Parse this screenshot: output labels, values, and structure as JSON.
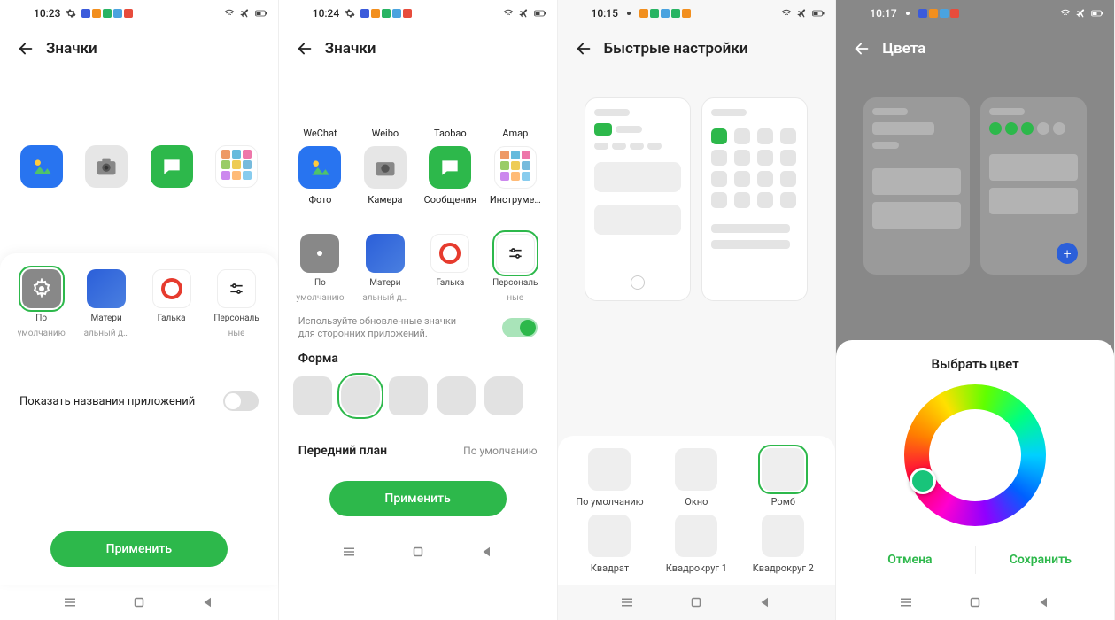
{
  "statusbar_dots": [
    "#3b5bdb",
    "#f28f1e",
    "#28b463",
    "#4aa3df",
    "#e74c3c"
  ],
  "statusbar_dots_s3": [
    "#f28f1e",
    "#28b463",
    "#4aa3df",
    "#28b463",
    "#f28f1e"
  ],
  "screen1": {
    "time": "10:23",
    "title": "Значки",
    "preview_icons": [
      {
        "name": "photos",
        "bg": "#2874f0"
      },
      {
        "name": "camera",
        "bg": "#e6e6e6"
      },
      {
        "name": "messages",
        "bg": "#2db84b"
      },
      {
        "name": "tools-folder",
        "multi": true
      }
    ],
    "styles": [
      {
        "name": "default",
        "label": "По",
        "label2": "умолчанию",
        "selected": true,
        "kind": "gear"
      },
      {
        "name": "material",
        "label": "Матери",
        "label2": "альный д…",
        "kind": "material"
      },
      {
        "name": "pebble",
        "label": "Галька",
        "kind": "circle"
      },
      {
        "name": "custom",
        "label": "Персональ",
        "label2": "ные",
        "kind": "sliders"
      }
    ],
    "show_names_label": "Показать названия приложений",
    "show_names_on": false,
    "apply": "Применить"
  },
  "screen2": {
    "time": "10:24",
    "title": "Значки",
    "row1": [
      {
        "name": "wechat",
        "label": "WeChat",
        "bg": "#2db84b"
      },
      {
        "name": "weibo",
        "label": "Weibo",
        "bg": "#e6e6e6"
      },
      {
        "name": "taobao",
        "label": "Taobao",
        "bg": "#2db84b"
      },
      {
        "name": "amap",
        "label": "Amap",
        "multi": true
      }
    ],
    "row2": [
      {
        "name": "photos",
        "label": "Фото",
        "bg": "#2874f0"
      },
      {
        "name": "camera",
        "label": "Камера",
        "bg": "#e6e6e6"
      },
      {
        "name": "messages",
        "label": "Сообщения",
        "bg": "#2db84b"
      },
      {
        "name": "tools",
        "label": "Инструме…",
        "multi": true
      }
    ],
    "styles": [
      {
        "name": "default",
        "label": "По",
        "label2": "умолчанию",
        "kind": "gear"
      },
      {
        "name": "material",
        "label": "Матери",
        "label2": "альный д…",
        "kind": "material"
      },
      {
        "name": "pebble",
        "label": "Галька",
        "kind": "circle"
      },
      {
        "name": "custom",
        "label": "Персональ",
        "label2": "ные",
        "kind": "sliders",
        "selected": true
      }
    ],
    "use_updated_desc": "Используйте обновленные значки для сторонних приложений.",
    "use_updated_on": true,
    "shape_title": "Форма",
    "shapes": [
      "r10",
      "squircle",
      "r10",
      "r14",
      "r14"
    ],
    "shape_selected": 1,
    "foreground_label": "Передний план",
    "foreground_value": "По умолчанию",
    "apply": "Применить"
  },
  "screen3": {
    "time": "10:15",
    "title": "Быстрые настройки",
    "options_row1": [
      {
        "name": "default",
        "label": "По умолчанию"
      },
      {
        "name": "window",
        "label": "Окно"
      },
      {
        "name": "rhomb",
        "label": "Ромб",
        "selected": true
      }
    ],
    "options_row2": [
      {
        "name": "square",
        "label": "Квадрат"
      },
      {
        "name": "squaround1",
        "label": "Квадрокруг 1"
      },
      {
        "name": "squaround2",
        "label": "Квадрокруг 2"
      }
    ]
  },
  "screen4": {
    "time": "10:17",
    "title": "Цвета",
    "sheet_title": "Выбрать цвет",
    "cancel": "Отмена",
    "save": "Сохранить"
  }
}
